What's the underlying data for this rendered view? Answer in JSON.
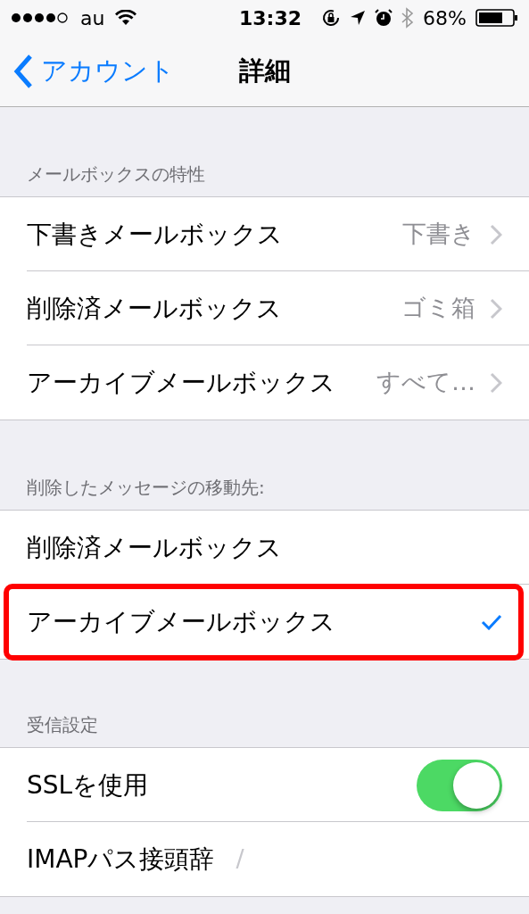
{
  "status_bar": {
    "carrier": "au",
    "time": "13:32",
    "battery": "68%"
  },
  "nav": {
    "back": "アカウント",
    "title": "詳細"
  },
  "sections": [
    {
      "header": "メールボックスの特性",
      "rows": [
        {
          "kind": "disclosure",
          "label": "下書きメールボックス",
          "value": "下書き"
        },
        {
          "kind": "disclosure",
          "label": "削除済メールボックス",
          "value": "ゴミ箱"
        },
        {
          "kind": "disclosure",
          "label": "アーカイブメールボックス",
          "value": "すべて…"
        }
      ]
    },
    {
      "header": "削除したメッセージの移動先:",
      "rows": [
        {
          "kind": "choice",
          "label": "削除済メールボックス",
          "selected": false,
          "highlighted": false
        },
        {
          "kind": "choice",
          "label": "アーカイブメールボックス",
          "selected": true,
          "highlighted": true
        }
      ]
    },
    {
      "header": "受信設定",
      "rows": [
        {
          "kind": "toggle",
          "label": "SSLを使用",
          "on": true
        },
        {
          "kind": "field",
          "label": "IMAPパス接頭辞",
          "value": "/"
        }
      ]
    }
  ]
}
